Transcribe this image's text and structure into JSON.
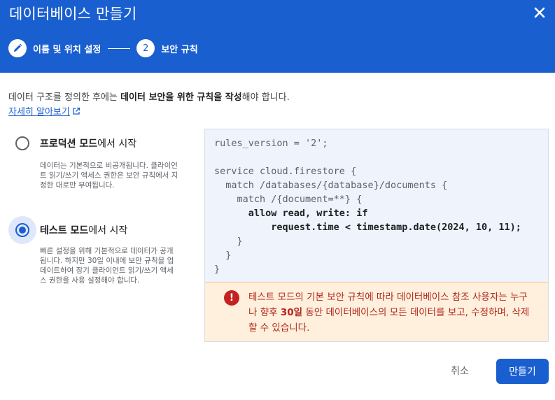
{
  "dialog": {
    "title": "데이터베이스 만들기",
    "close_icon": "close-icon"
  },
  "stepper": {
    "step1": {
      "label": "이름 및 위치 설정",
      "icon": "pencil-icon",
      "state": "done"
    },
    "step2": {
      "number": "2",
      "label": "보안 규칙",
      "state": "active"
    }
  },
  "intro": {
    "part1": "데이터 구조를 정의한 후에는 ",
    "bold1": "데이터 보안을 위한 규칙을 작성",
    "part2": "해야 합니다.",
    "link_label": "자세히 알아보기",
    "link_icon": "open-in-new-icon"
  },
  "modes": {
    "production": {
      "bold": "프로덕션 모드",
      "suffix": "에서 시작",
      "description": "데이터는 기본적으로 비공개됩니다. 클라이언트 읽기/쓰기 액세스 권한은 보안 규칙에서 지정한 대로만 부여됩니다.",
      "selected": false
    },
    "test": {
      "bold": "테스트 모드",
      "suffix": "에서 시작",
      "description": "빠른 설정을 위해 기본적으로 데이터가 공개됩니다. 하지만 30일 이내에 보안 규칙을 업데이트하여 장기 클라이언트 읽기/쓰기 액세스 권한을 사용 설정해야 합니다.",
      "selected": true
    }
  },
  "code": {
    "line1": "rules_version = '2';",
    "line3": "service cloud.firestore {",
    "line4": "  match /databases/{database}/documents {",
    "line5": "    match /{document=**} {",
    "line6": "      allow read, write: if",
    "line7": "          request.time < timestamp.date(2024, 10, 11);",
    "line8": "    }",
    "line9": "  }",
    "line10": "}"
  },
  "warning": {
    "icon": "error-icon",
    "part1": "테스트 모드의 기본 보안 규칙에 따라 데이터베이스 참조 사용자는 누구나 향후 ",
    "bold": "30일",
    "part2": " 동안 데이터베이스의 모든 데이터를 보고, 수정하며, 삭제할 수 있습니다."
  },
  "actions": {
    "cancel": "취소",
    "create": "만들기"
  },
  "colors": {
    "primary": "#1a5fd0",
    "warning_bg": "#fef0dc",
    "warning_text": "#b3261e",
    "code_bg": "#eef3fc"
  }
}
